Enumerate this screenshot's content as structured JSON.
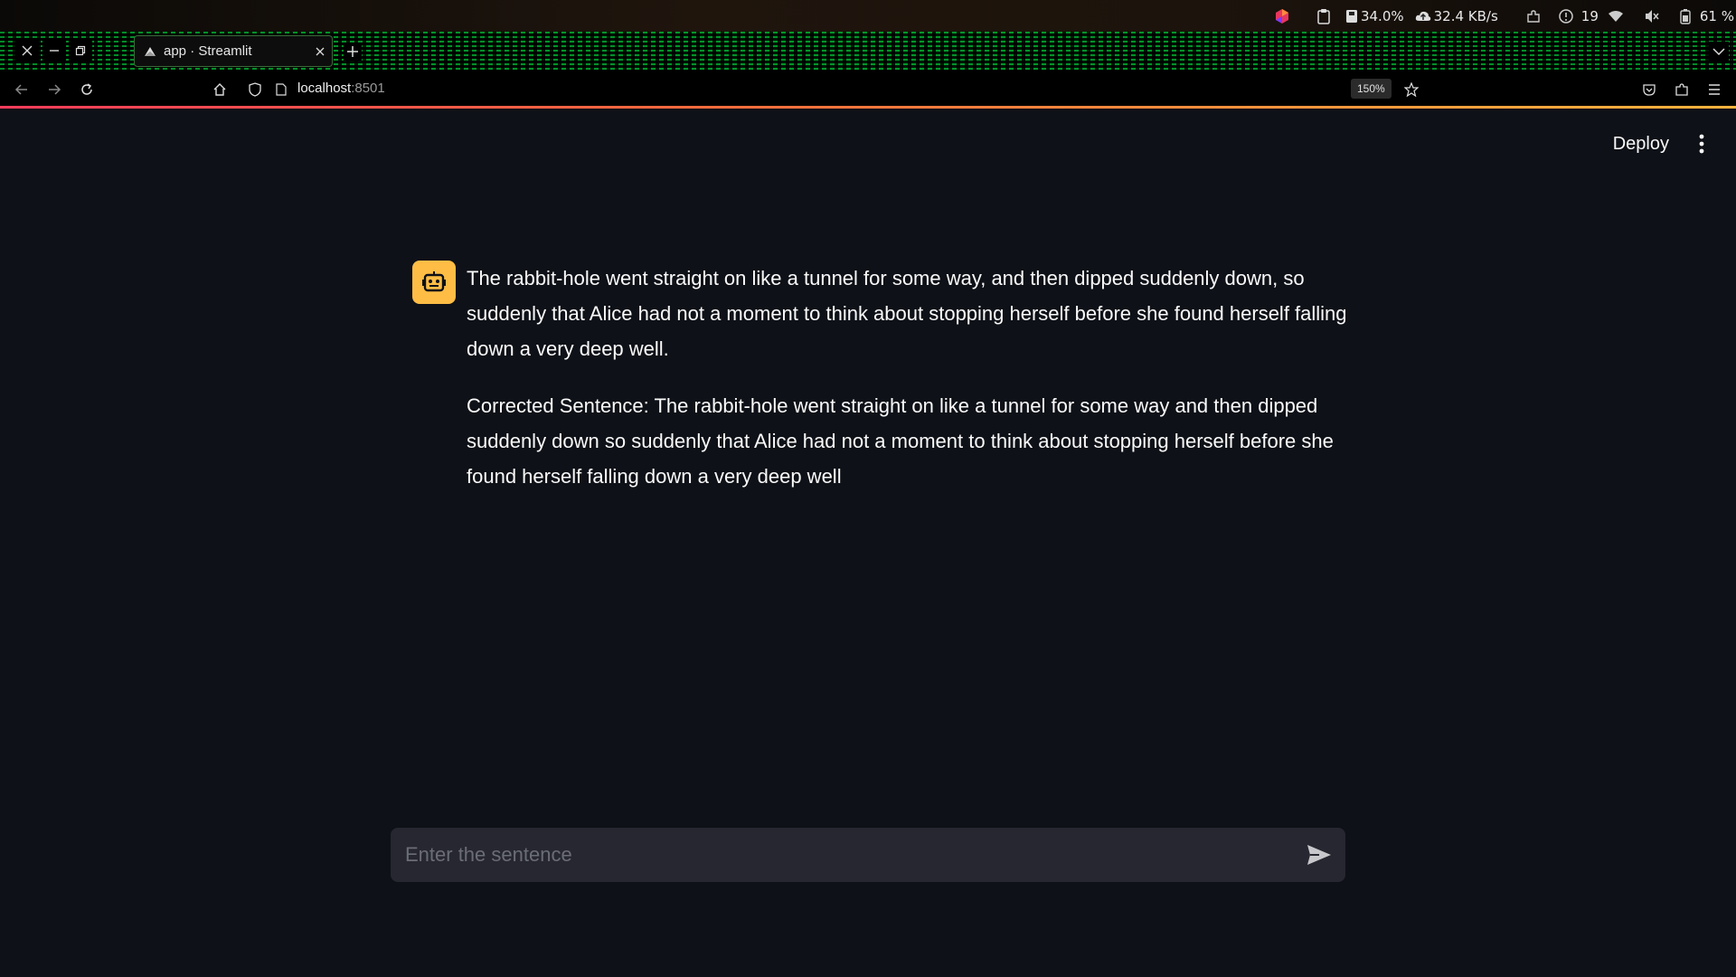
{
  "system_bar": {
    "cpu": "34.0%",
    "network": "32.4 KB/s",
    "updates": "19",
    "battery": "61 %"
  },
  "browser": {
    "tab_title": "app · Streamlit",
    "url_host": "localhost",
    "url_port": ":8501",
    "zoom": "150%"
  },
  "app": {
    "deploy_label": "Deploy",
    "messages": [
      {
        "role": "assistant",
        "paragraphs": [
          "The rabbit-hole went straight on like a tunnel for some way, and then dipped suddenly down, so suddenly that Alice had not a moment to think about stopping herself before she found herself falling down a very deep well.",
          "Corrected Sentence: The rabbit-hole went straight on like a tunnel for some way and then dipped suddenly down so suddenly that Alice had not a moment to think about stopping herself before she found herself falling down a very deep well"
        ]
      }
    ],
    "chat_input": {
      "placeholder": "Enter the sentence",
      "value": ""
    }
  },
  "icons": {
    "avatar": "robot-icon",
    "send": "send-arrow-icon",
    "menu": "kebab-menu-icon"
  },
  "colors": {
    "app_bg": "#0e1117",
    "avatar_bg": "#ffbd45",
    "input_bg": "#262730",
    "text": "#fafafa"
  }
}
